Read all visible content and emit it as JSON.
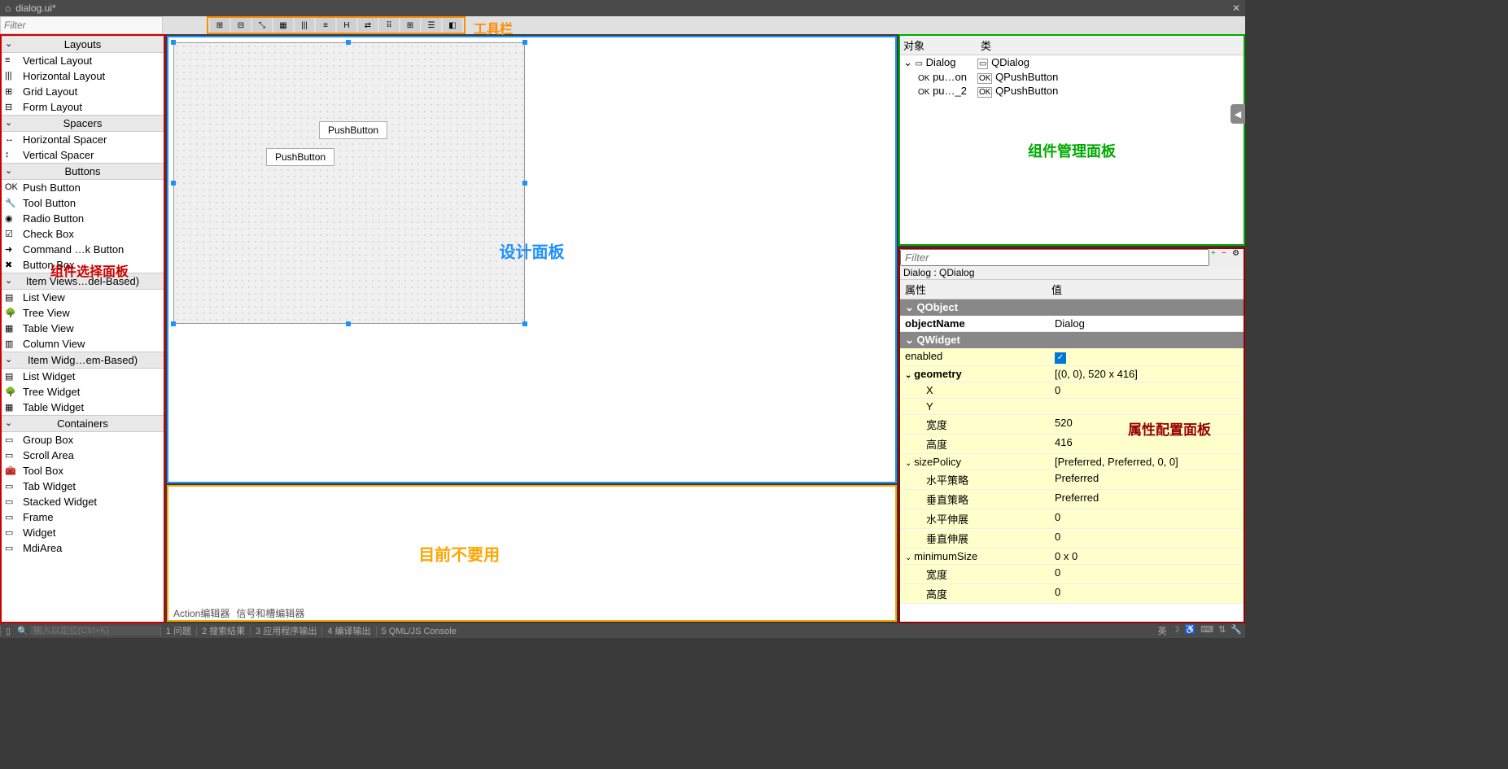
{
  "window": {
    "title": "dialog.ui*"
  },
  "annotations": {
    "toolbar": "工具栏",
    "widget_box": "组件选择面板",
    "design": "设计面板",
    "object": "组件管理面板",
    "property": "属性配置面板",
    "bottom": "目前不要用"
  },
  "toolbar_icons": [
    "layout-h",
    "layout-v",
    "break",
    "align",
    "columns",
    "rows",
    "h-split",
    "v-split",
    "grid",
    "grid2",
    "form",
    "preview"
  ],
  "widget_box_filter": "Filter",
  "widget_categories": [
    {
      "name": "Layouts",
      "items": [
        {
          "icon": "≡",
          "label": "Vertical Layout"
        },
        {
          "icon": "|||",
          "label": "Horizontal Layout"
        },
        {
          "icon": "⊞",
          "label": "Grid Layout"
        },
        {
          "icon": "⊟",
          "label": "Form Layout"
        }
      ]
    },
    {
      "name": "Spacers",
      "items": [
        {
          "icon": "↔",
          "label": "Horizontal Spacer"
        },
        {
          "icon": "↕",
          "label": "Vertical Spacer"
        }
      ]
    },
    {
      "name": "Buttons",
      "items": [
        {
          "icon": "OK",
          "label": "Push Button"
        },
        {
          "icon": "🔧",
          "label": "Tool Button"
        },
        {
          "icon": "◉",
          "label": "Radio Button"
        },
        {
          "icon": "☑",
          "label": "Check Box"
        },
        {
          "icon": "➜",
          "label": "Command …k Button"
        },
        {
          "icon": "✖",
          "label": "Button Box"
        }
      ]
    },
    {
      "name": "Item Views…del-Based)",
      "items": [
        {
          "icon": "▤",
          "label": "List View"
        },
        {
          "icon": "🌳",
          "label": "Tree View"
        },
        {
          "icon": "▦",
          "label": "Table View"
        },
        {
          "icon": "▥",
          "label": "Column View"
        }
      ]
    },
    {
      "name": "Item Widg…em-Based)",
      "items": [
        {
          "icon": "▤",
          "label": "List Widget"
        },
        {
          "icon": "🌳",
          "label": "Tree Widget"
        },
        {
          "icon": "▦",
          "label": "Table Widget"
        }
      ]
    },
    {
      "name": "Containers",
      "items": [
        {
          "icon": "▭",
          "label": "Group Box"
        },
        {
          "icon": "▭",
          "label": "Scroll Area"
        },
        {
          "icon": "🧰",
          "label": "Tool Box"
        },
        {
          "icon": "▭",
          "label": "Tab Widget"
        },
        {
          "icon": "▭",
          "label": "Stacked Widget"
        },
        {
          "icon": "▭",
          "label": "Frame"
        },
        {
          "icon": "▭",
          "label": "Widget"
        },
        {
          "icon": "▭",
          "label": "MdiArea"
        }
      ]
    }
  ],
  "canvas_buttons": [
    {
      "label": "PushButton"
    },
    {
      "label": "PushButton"
    }
  ],
  "object_inspector": {
    "headers": [
      "对象",
      "类"
    ],
    "rows": [
      {
        "indent": 0,
        "prefix": "⌄",
        "icon": "▭",
        "name": "Dialog",
        "cls": "QDialog"
      },
      {
        "indent": 1,
        "prefix": "",
        "icon": "OK",
        "name": "pu…on",
        "cls": "QPushButton"
      },
      {
        "indent": 1,
        "prefix": "",
        "icon": "OK",
        "name": "pu…_2",
        "cls": "QPushButton"
      }
    ]
  },
  "property_editor": {
    "filter": "Filter",
    "context": "Dialog : QDialog",
    "headers": [
      "属性",
      "值"
    ],
    "groups": [
      {
        "name": "QObject",
        "rows": [
          {
            "name": "objectName",
            "value": "Dialog",
            "bold": true
          }
        ]
      },
      {
        "name": "QWidget",
        "rows": [
          {
            "name": "enabled",
            "value": "__check__",
            "yellow": true
          },
          {
            "name": "geometry",
            "value": "[(0, 0), 520 x 416]",
            "bold": true,
            "yellow": true,
            "expand": true
          },
          {
            "name": "X",
            "value": "0",
            "yellow": true,
            "sub": true
          },
          {
            "name": "Y",
            "value": "",
            "yellow": true,
            "sub": true
          },
          {
            "name": "宽度",
            "value": "520",
            "yellow": true,
            "sub": true
          },
          {
            "name": "高度",
            "value": "416",
            "yellow": true,
            "sub": true
          },
          {
            "name": "sizePolicy",
            "value": "[Preferred, Preferred, 0, 0]",
            "yellow": true,
            "expand": true
          },
          {
            "name": "水平策略",
            "value": "Preferred",
            "yellow": true,
            "sub": true
          },
          {
            "name": "垂直策略",
            "value": "Preferred",
            "yellow": true,
            "sub": true
          },
          {
            "name": "水平伸展",
            "value": "0",
            "yellow": true,
            "sub": true
          },
          {
            "name": "垂直伸展",
            "value": "0",
            "yellow": true,
            "sub": true
          },
          {
            "name": "minimumSize",
            "value": "0 x 0",
            "yellow": true,
            "expand": true
          },
          {
            "name": "宽度",
            "value": "0",
            "yellow": true,
            "sub": true
          },
          {
            "name": "高度",
            "value": "0",
            "yellow": true,
            "sub": true
          }
        ]
      }
    ]
  },
  "bottom_tabs": [
    "Action编辑器",
    "信号和槽编辑器"
  ],
  "statusbar": {
    "locator_placeholder": "输入以定位(Ctrl+K)",
    "items": [
      "1 问题",
      "2 搜索结果",
      "3 应用程序输出",
      "4 编译输出",
      "5 QML/JS Console"
    ],
    "ime": "英"
  }
}
